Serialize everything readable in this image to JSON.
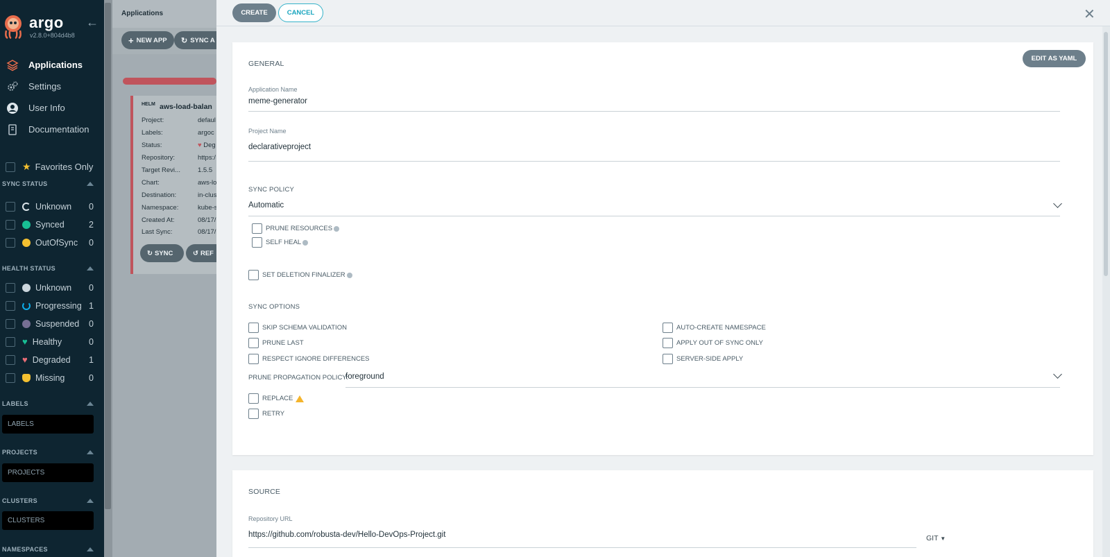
{
  "sidebar": {
    "brand": "argo",
    "version": "v2.8.0+804d4b8",
    "nav": [
      {
        "label": "Applications",
        "icon": "stack-icon"
      },
      {
        "label": "Settings",
        "icon": "gears-icon"
      },
      {
        "label": "User Info",
        "icon": "user-circle-icon"
      },
      {
        "label": "Documentation",
        "icon": "book-icon"
      }
    ],
    "favorites_label": "Favorites Only",
    "sync_status": {
      "title": "SYNC STATUS",
      "items": [
        {
          "label": "Unknown",
          "count": "0",
          "color": "#dee6eb"
        },
        {
          "label": "Synced",
          "count": "2",
          "color": "#18be94"
        },
        {
          "label": "OutOfSync",
          "count": "0",
          "color": "#f4c030"
        }
      ]
    },
    "health_status": {
      "title": "HEALTH STATUS",
      "items": [
        {
          "label": "Unknown",
          "count": "0",
          "color": "#ccd6dd"
        },
        {
          "label": "Progressing",
          "count": "1",
          "color": "#0dadea"
        },
        {
          "label": "Suspended",
          "count": "0",
          "color": "#766f94"
        },
        {
          "label": "Healthy",
          "count": "0",
          "color": "#18be94"
        },
        {
          "label": "Degraded",
          "count": "1",
          "color": "#e96d76"
        },
        {
          "label": "Missing",
          "count": "0",
          "color": "#f4c030"
        }
      ]
    },
    "labels": {
      "title": "LABELS",
      "placeholder": "LABELS"
    },
    "projects": {
      "title": "PROJECTS",
      "placeholder": "PROJECTS"
    },
    "clusters": {
      "title": "CLUSTERS",
      "placeholder": "CLUSTERS"
    },
    "namespaces": {
      "title": "NAMESPACES"
    }
  },
  "background": {
    "page_title": "Applications",
    "new_app": "NEW APP",
    "sync_apps": "SYNC A",
    "card": {
      "helm": "HELM",
      "title": "aws-load-balan",
      "rows": [
        {
          "k": "Project:",
          "v": "defaul"
        },
        {
          "k": "Labels:",
          "v": "argoc"
        },
        {
          "k": "Status:",
          "v": "Deg"
        },
        {
          "k": "Repository:",
          "v": "https:/"
        },
        {
          "k": "Target Revi...",
          "v": "1.5.5"
        },
        {
          "k": "Chart:",
          "v": "aws-lo"
        },
        {
          "k": "Destination:",
          "v": "in-clus"
        },
        {
          "k": "Namespace:",
          "v": "kube-s"
        },
        {
          "k": "Created At:",
          "v": "08/17/"
        },
        {
          "k": "Last Sync:",
          "v": "08/17/"
        }
      ],
      "sync_btn": "SYNC",
      "refresh_btn": "REF"
    }
  },
  "panel": {
    "create": "CREATE",
    "cancel": "CANCEL",
    "edit_yaml": "EDIT AS YAML",
    "general": {
      "title": "GENERAL",
      "app_name_label": "Application Name",
      "app_name": "meme-generator",
      "project_label": "Project Name",
      "project": "declarativeproject"
    },
    "sync_policy": {
      "title": "SYNC POLICY",
      "value": "Automatic",
      "prune": "PRUNE RESOURCES",
      "self_heal": "SELF HEAL",
      "finalizer": "SET DELETION FINALIZER"
    },
    "sync_options": {
      "title": "SYNC OPTIONS",
      "left": [
        "SKIP SCHEMA VALIDATION",
        "PRUNE LAST",
        "RESPECT IGNORE DIFFERENCES"
      ],
      "right": [
        "AUTO-CREATE NAMESPACE",
        "APPLY OUT OF SYNC ONLY",
        "SERVER-SIDE APPLY"
      ],
      "prune_policy_label": "PRUNE PROPAGATION POLICY:",
      "prune_policy": "foreground",
      "replace": "REPLACE",
      "retry": "RETRY"
    },
    "source": {
      "title": "SOURCE",
      "repo_label": "Repository URL",
      "repo": "https://github.com/robusta-dev/Hello-DevOps-Project.git",
      "type": "GIT"
    }
  }
}
